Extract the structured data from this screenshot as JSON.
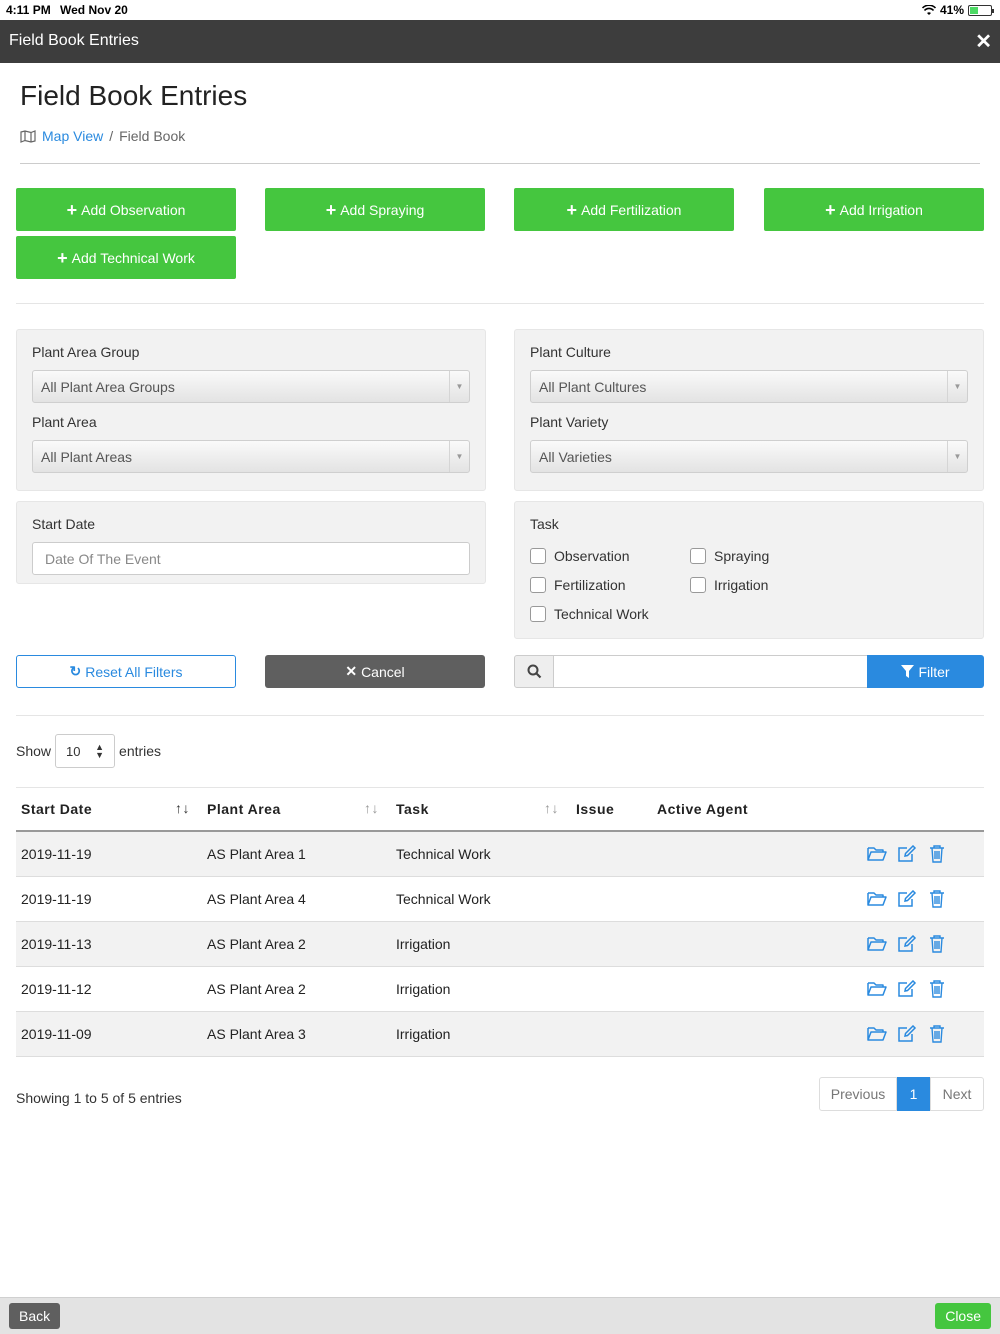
{
  "status": {
    "time": "4:11 PM",
    "date": "Wed Nov 20",
    "battery": "41%"
  },
  "window": {
    "title": "Field Book Entries",
    "close_icon": "close-icon"
  },
  "page": {
    "title": "Field Book Entries"
  },
  "breadcrumb": {
    "link": "Map View",
    "separator": "/",
    "current": "Field Book"
  },
  "add_buttons": {
    "observation": "Add Observation",
    "spraying": "Add Spraying",
    "fertilization": "Add Fertilization",
    "irrigation": "Add Irrigation",
    "technical": "Add Technical Work"
  },
  "filters": {
    "plant_area_group": {
      "label": "Plant Area Group",
      "value": "All Plant Area Groups"
    },
    "plant_area": {
      "label": "Plant Area",
      "value": "All Plant Areas"
    },
    "plant_culture": {
      "label": "Plant Culture",
      "value": "All Plant Cultures"
    },
    "plant_variety": {
      "label": "Plant Variety",
      "value": "All Varieties"
    },
    "start_date": {
      "label": "Start Date",
      "placeholder": "Date Of The Event"
    },
    "task": {
      "label": "Task",
      "options": [
        "Observation",
        "Spraying",
        "Fertilization",
        "Irrigation",
        "Technical Work"
      ]
    }
  },
  "actions": {
    "reset": "Reset All Filters",
    "cancel": "Cancel",
    "filter": "Filter"
  },
  "table_controls": {
    "show": "Show",
    "page_size": "10",
    "entries": "entries"
  },
  "table": {
    "columns": [
      "Start Date",
      "Plant Area",
      "Task",
      "Issue",
      "Active Agent"
    ],
    "rows": [
      {
        "start_date": "2019-11-19",
        "plant_area": "AS Plant Area 1",
        "task": "Technical Work",
        "issue": "",
        "agent": ""
      },
      {
        "start_date": "2019-11-19",
        "plant_area": "AS Plant Area 4",
        "task": "Technical Work",
        "issue": "",
        "agent": ""
      },
      {
        "start_date": "2019-11-13",
        "plant_area": "AS Plant Area 2",
        "task": "Irrigation",
        "issue": "",
        "agent": ""
      },
      {
        "start_date": "2019-11-12",
        "plant_area": "AS Plant Area 2",
        "task": "Irrigation",
        "issue": "",
        "agent": ""
      },
      {
        "start_date": "2019-11-09",
        "plant_area": "AS Plant Area 3",
        "task": "Irrigation",
        "issue": "",
        "agent": ""
      }
    ]
  },
  "pagination": {
    "info": "Showing 1 to 5 of 5 entries",
    "previous": "Previous",
    "current": "1",
    "next": "Next"
  },
  "bottom": {
    "back": "Back",
    "close": "Close"
  },
  "colors": {
    "green": "#45c63f",
    "blue": "#2a8adf",
    "dark": "#3d3d3d"
  }
}
